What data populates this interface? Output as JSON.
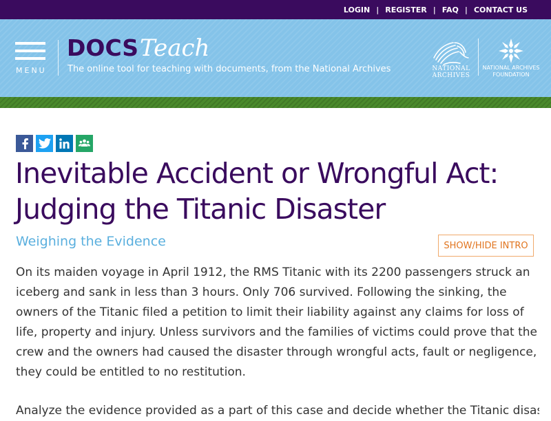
{
  "top_nav": {
    "links": [
      "LOGIN",
      "REGISTER",
      "FAQ",
      "CONTACT US"
    ],
    "separator": "|"
  },
  "header": {
    "menu_label": "MENU",
    "logo_docs": "DOCS",
    "logo_teach": "Teach",
    "tagline": "The online tool for teaching with documents, from the National Archives",
    "na_logo_text": [
      "NATIONAL",
      "ARCHIVES"
    ],
    "naf_logo_text": [
      "NATIONAL ARCHIVES",
      "FOUNDATION"
    ]
  },
  "share": {
    "icons": [
      "facebook-icon",
      "twitter-icon",
      "linkedin-icon",
      "google-classroom-icon"
    ]
  },
  "main": {
    "title_line1": "Inevitable Accident or Wrongful Act:",
    "title_line2": "Judging the Titanic Disaster",
    "subtitle": "Weighing the Evidence",
    "toggle_label": "SHOW/HIDE INTRO",
    "intro_p1": "On its maiden voyage in April 1912, the RMS Titanic with its 2200 passengers struck an iceberg and sank in less than 3 hours. Only 706 survived. Following the sinking, the owners of the Titanic filed a petition to limit their liability against any claims for loss of life, property and injury. Unless survivors and the families of victims could prove that the crew and the owners had caused the disaster through wrongful acts, fault or negligence, they could be entitled to no restitution.",
    "intro_p2": "Analyze the evidence provided as a part of this case and decide whether the Titanic disaster"
  },
  "colors": {
    "top_bar": "#3a0b5e",
    "header_bg": "#84c3e9",
    "green_band": "#4a8a2b",
    "title": "#3a0b5e",
    "subtitle": "#5aafde",
    "accent_orange": "#e1751f"
  }
}
